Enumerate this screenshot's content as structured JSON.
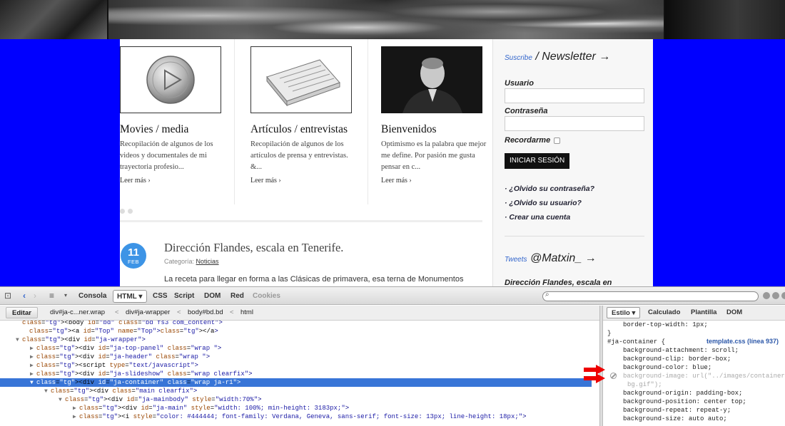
{
  "website": {
    "cards": [
      {
        "title": "Movies / media",
        "desc": "Recopilación de algunos de los videos y documentales de mi trayectoria profesio...",
        "more": "Leer más ›",
        "thumb_icon": "play-button-icon"
      },
      {
        "title": "Artículos / entrevistas",
        "desc": "Recopilación de algunos de los artículos de prensa y entrevistas. &...",
        "more": "Leer más ›",
        "thumb_icon": "newspaper-icon"
      },
      {
        "title": "Bienvenidos",
        "desc": "Optimismo es la palabra que mejor me define. Por pasión me gusta pensar en c...",
        "more": "Leer más ›",
        "thumb_icon": "portrait-photo"
      }
    ],
    "article": {
      "day": "11",
      "month": "FEB",
      "title": "Dirección Flandes, escala en Tenerife.",
      "category_label": "Categoría:",
      "category_link": "Noticias",
      "text": "La receta para llegar en forma a las Clásicas de primavera, esa terna de Monumentos"
    },
    "sidebar": {
      "newsletter_small": "Suscribe",
      "newsletter_big": "/ Newsletter",
      "arrow": "→",
      "user_label": "Usuario",
      "password_label": "Contraseña",
      "remember_label": "Recordarme",
      "login_button": "INICIAR SESIÓN",
      "links": [
        "· ¿Olvido su contraseña?",
        "· ¿Olvido su usuario?",
        "· Crear una cuenta"
      ],
      "tweets_small": "Tweets",
      "tweets_big": "@Matxin_",
      "tweet_preview": "Dirección Flandes, escala en"
    }
  },
  "devtools": {
    "toolbar": {
      "tabs": [
        "Consola",
        "HTML ▾",
        "CSS",
        "Script",
        "DOM",
        "Red",
        "Cookies"
      ]
    },
    "breadcrumb": {
      "edit": "Editar",
      "items": [
        "div#ja-c...ner.wrap",
        "div#ja-wrapper",
        "body#bd.bd",
        "html"
      ],
      "separator": "<"
    },
    "html_tree": [
      {
        "indent": 2,
        "twisty": "",
        "text": "<body id=\"bd\" class=\"bd fs3 com_content\">"
      },
      {
        "indent": 3,
        "twisty": "",
        "text": "<a id=\"Top\" name=\"Top\"></a>"
      },
      {
        "indent": 2,
        "twisty": "▼",
        "text": "<div id=\"ja-wrapper\">"
      },
      {
        "indent": 4,
        "twisty": "▶",
        "text": "<div id=\"ja-top-panel\" class=\"wrap \">"
      },
      {
        "indent": 4,
        "twisty": "▶",
        "text": "<div id=\"ja-header\" class=\"wrap \">"
      },
      {
        "indent": 4,
        "twisty": "▶",
        "text": "<script type=\"text/javascript\">"
      },
      {
        "indent": 4,
        "twisty": "▶",
        "text": "<div id=\"ja-slideshow\" class=\"wrap clearfix\">"
      },
      {
        "indent": 4,
        "twisty": "▼",
        "text": "<div id=\"ja-container\" class=\"wrap ja-r1\">",
        "selected": true
      },
      {
        "indent": 6,
        "twisty": "▼",
        "text": "<div class=\"main clearfix\">"
      },
      {
        "indent": 8,
        "twisty": "▼",
        "text": "<div id=\"ja-mainbody\" style=\"width:70%\">"
      },
      {
        "indent": 10,
        "twisty": "▶",
        "text": "<div id=\"ja-main\" style=\"width: 100%; min-height: 3183px;\">"
      },
      {
        "indent": 10,
        "twisty": "▶",
        "text": "<i style=\"color: #444444; font-family: Verdana, Geneva, sans-serif; font-size: 13px; line-height: 18px;\">"
      }
    ],
    "style_tabs": [
      "Estilo ▾",
      "Calculado",
      "Plantilla",
      "DOM"
    ],
    "style": {
      "prev_prop": "border-top-width: 1px;",
      "close_brace": "}",
      "selector": "#ja-container {",
      "source": "template.css (línea 937)",
      "props": [
        "background-attachment: scroll;",
        "background-clip: border-box;",
        "background-color: blue;",
        "background-image: url(\"../images/container-",
        "bg.gif\");",
        "background-origin: padding-box;",
        "background-position: center top;",
        "background-repeat: repeat-y;",
        "background-size: auto auto;"
      ]
    }
  }
}
